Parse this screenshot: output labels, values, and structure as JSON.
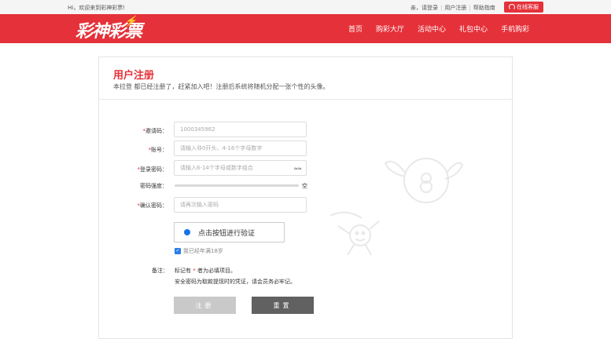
{
  "topbar": {
    "welcome": "Hi，欢迎来到彩神彩票!",
    "links": [
      "亲，请登录",
      "用户注册",
      "帮助指南"
    ],
    "service_label": "在线客服"
  },
  "header": {
    "logo_text": "彩神彩票",
    "nav": [
      "首页",
      "购彩大厅",
      "活动中心",
      "礼包中心",
      "手机购彩"
    ]
  },
  "form": {
    "title": "用户注册",
    "subtitle": "本拉登 都已经注册了，赶紧加入吧！注册后系统将随机分配一张个性的头像。",
    "invite": {
      "label": "邀请码：",
      "value": "1000345962"
    },
    "account": {
      "label": "账号：",
      "placeholder": "请输入非0开头、4-16个字母数字"
    },
    "password": {
      "label": "登录密码：",
      "placeholder": "请输入6-14个字母或数字组合"
    },
    "strength": {
      "label": "密码强度：",
      "value_text": "空",
      "level": 0
    },
    "confirm": {
      "label": "确认密码：",
      "placeholder": "请再次输入密码"
    },
    "verify_label": "点击按钮进行验证",
    "age_checkbox": {
      "label": "我已经年满18岁",
      "checked": true
    },
    "note_label": "备注：",
    "note1_pre": "标记有 ",
    "note1_star": "*",
    "note1_post": " 者为必填项目。",
    "note2": "安全密码为取款提现时的凭证，请会员务必牢记。",
    "register_button": "注册",
    "reset_button": "重置"
  },
  "colors": {
    "brand_red": "#e5313a",
    "checkbox_blue": "#2b7de9",
    "reset_gray": "#616161",
    "register_disabled": "#c9c9c9"
  }
}
